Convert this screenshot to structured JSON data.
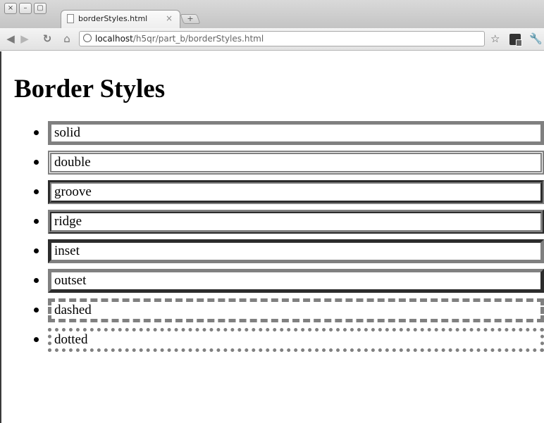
{
  "window": {
    "controls": [
      "×",
      "–",
      "▢"
    ],
    "tab": {
      "title": "borderStyles.html",
      "close": "×"
    },
    "new_tab": "+"
  },
  "toolbar": {
    "url_host": "localhost",
    "url_path": "/h5qr/part_b/borderStyles.html"
  },
  "page": {
    "heading": "Border Styles",
    "items": [
      {
        "label": "solid"
      },
      {
        "label": "double"
      },
      {
        "label": "groove"
      },
      {
        "label": "ridge"
      },
      {
        "label": "inset"
      },
      {
        "label": "outset"
      },
      {
        "label": "dashed"
      },
      {
        "label": "dotted"
      }
    ],
    "border_color": "#808080"
  }
}
